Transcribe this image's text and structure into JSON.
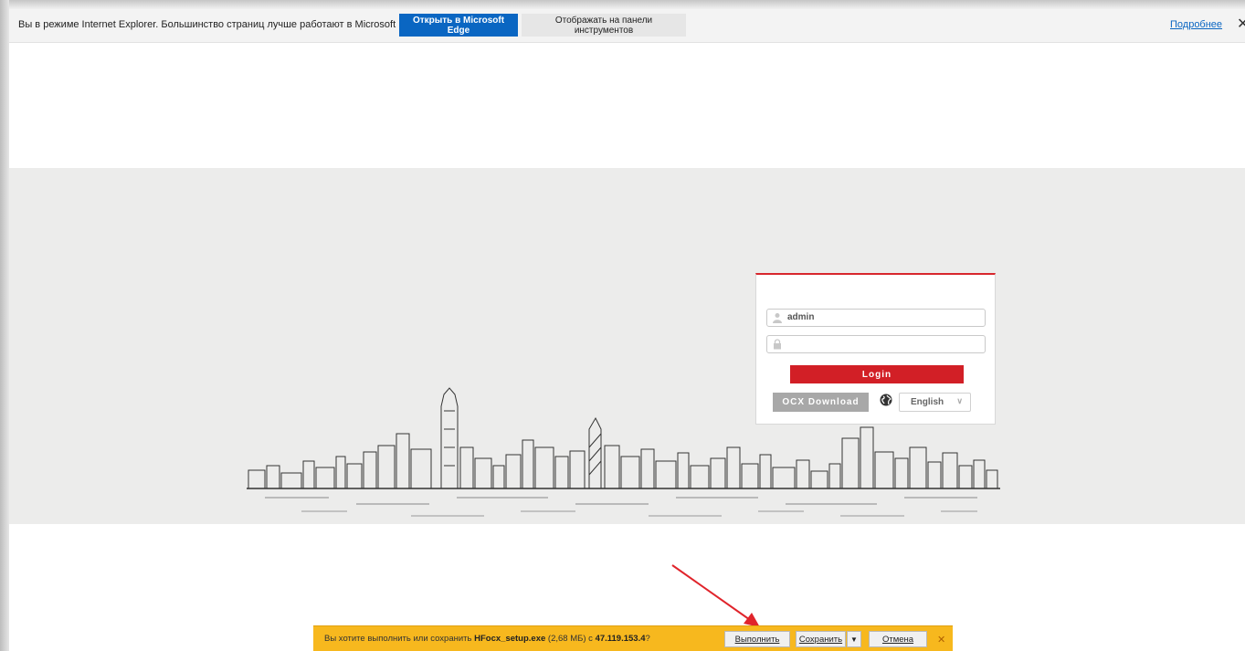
{
  "infobar": {
    "message": "Вы в режиме Internet Explorer. Большинство страниц лучше работают в Microsoft Edge.",
    "open_edge_label": "Открыть в Microsoft Edge",
    "show_toolbar_label": "Отображать на панели инструментов",
    "learn_more_label": "Подробнее",
    "close_glyph": "✕"
  },
  "login": {
    "username_value": "admin",
    "password_value": "",
    "login_label": "Login",
    "ocx_label": "OCX Download",
    "language_value": "English",
    "accent_color": "#d21f26"
  },
  "download_bar": {
    "prompt_prefix": "Вы хотите выполнить или сохранить ",
    "file_name": "HFocx_setup.exe",
    "file_size": " (2,68 МБ) с ",
    "source": "47.119.153.4",
    "prompt_suffix": "?",
    "run_label": "Выполнить",
    "save_label": "Сохранить",
    "cancel_label": "Отмена",
    "close_glyph": "✕",
    "bar_color": "#f7b81e"
  },
  "annotation": {
    "arrow_color": "#e0242b"
  }
}
